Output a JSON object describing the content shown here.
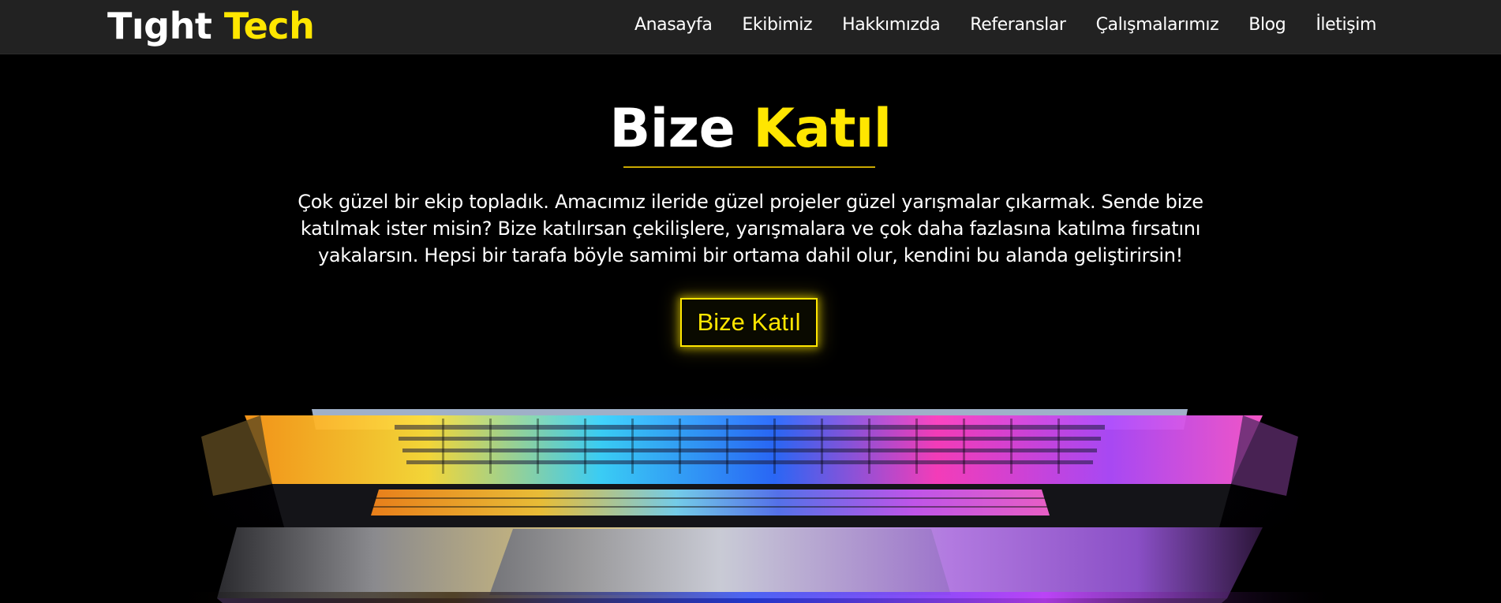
{
  "navbar": {
    "brand_part1": "Tıght",
    "brand_part2": "Tech",
    "items": [
      {
        "label": "Anasayfa"
      },
      {
        "label": "Ekibimiz"
      },
      {
        "label": "Hakkımızda"
      },
      {
        "label": "Referanslar"
      },
      {
        "label": "Çalışmalarımız"
      },
      {
        "label": "Blog"
      },
      {
        "label": "İletişim"
      }
    ]
  },
  "hero": {
    "title_part1": "Bize",
    "title_part2": "Katıl",
    "text": "Çok güzel bir ekip topladık. Amacımız ileride güzel projeler güzel yarışmalar çıkarmak. Sende bize katılmak ister misin? Bize katılırsan çekilişlere, yarışmalara ve çok daha fazlasına katılma fırsatını yakalarsın. Hepsi bir tarafa böyle samimi bir ortama dahil olur, kendini bu alanda geliştirirsin!",
    "button_label": "Bize Katıl"
  },
  "colors": {
    "accent": "#ffe600",
    "navbar_bg": "#222222",
    "hero_bg": "#000000",
    "text": "#ffffff"
  }
}
